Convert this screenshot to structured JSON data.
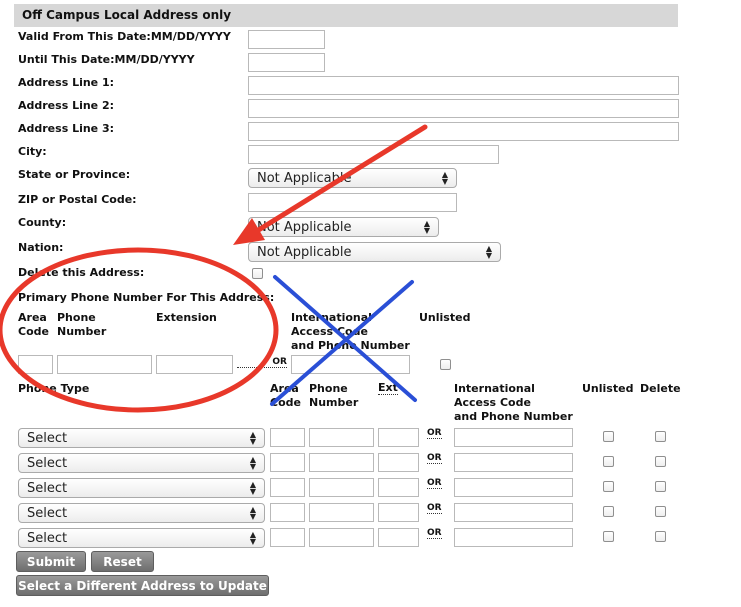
{
  "section_title": "Off Campus Local Address only",
  "fields": {
    "valid_from": "Valid From This Date:MM/DD/YYYY",
    "until": "Until This Date:MM/DD/YYYY",
    "addr1": "Address Line 1:",
    "addr2": "Address Line 2:",
    "addr3": "Address Line 3:",
    "city": "City:",
    "state": "State or Province:",
    "zip": "ZIP or Postal Code:",
    "county": "County:",
    "nation": "Nation:",
    "delete_addr": "Delete this Address:",
    "primary_phone": "Primary Phone Number For This Address:"
  },
  "selects": {
    "state": "Not Applicable",
    "county": "Not Applicable",
    "nation": "Not Applicable"
  },
  "primary_headers": {
    "area": "Area",
    "code": "Code",
    "phone": "Phone",
    "number": "Number",
    "extension": "Extension",
    "intl1": "International",
    "intl2": "Access Code",
    "intl3": "and Phone Number",
    "unlisted": "Unlisted"
  },
  "or_text": "OR",
  "phone_table": {
    "phone_type": "Phone Type",
    "area": "Area",
    "code": "Code",
    "phone": "Phone",
    "number": "Number",
    "ext": "Ext",
    "intl1": "International",
    "intl2": "Access Code",
    "intl3": "and Phone Number",
    "unlisted": "Unlisted",
    "delete": "Delete",
    "rows": [
      "Select",
      "Select",
      "Select",
      "Select",
      "Select"
    ]
  },
  "buttons": {
    "submit": "Submit",
    "reset": "Reset",
    "select_different": "Select a Different Address to Update"
  },
  "colors": {
    "annotation_red": "#e8382a",
    "annotation_blue": "#2a4fd6",
    "header_bg": "#d7d7d7"
  }
}
